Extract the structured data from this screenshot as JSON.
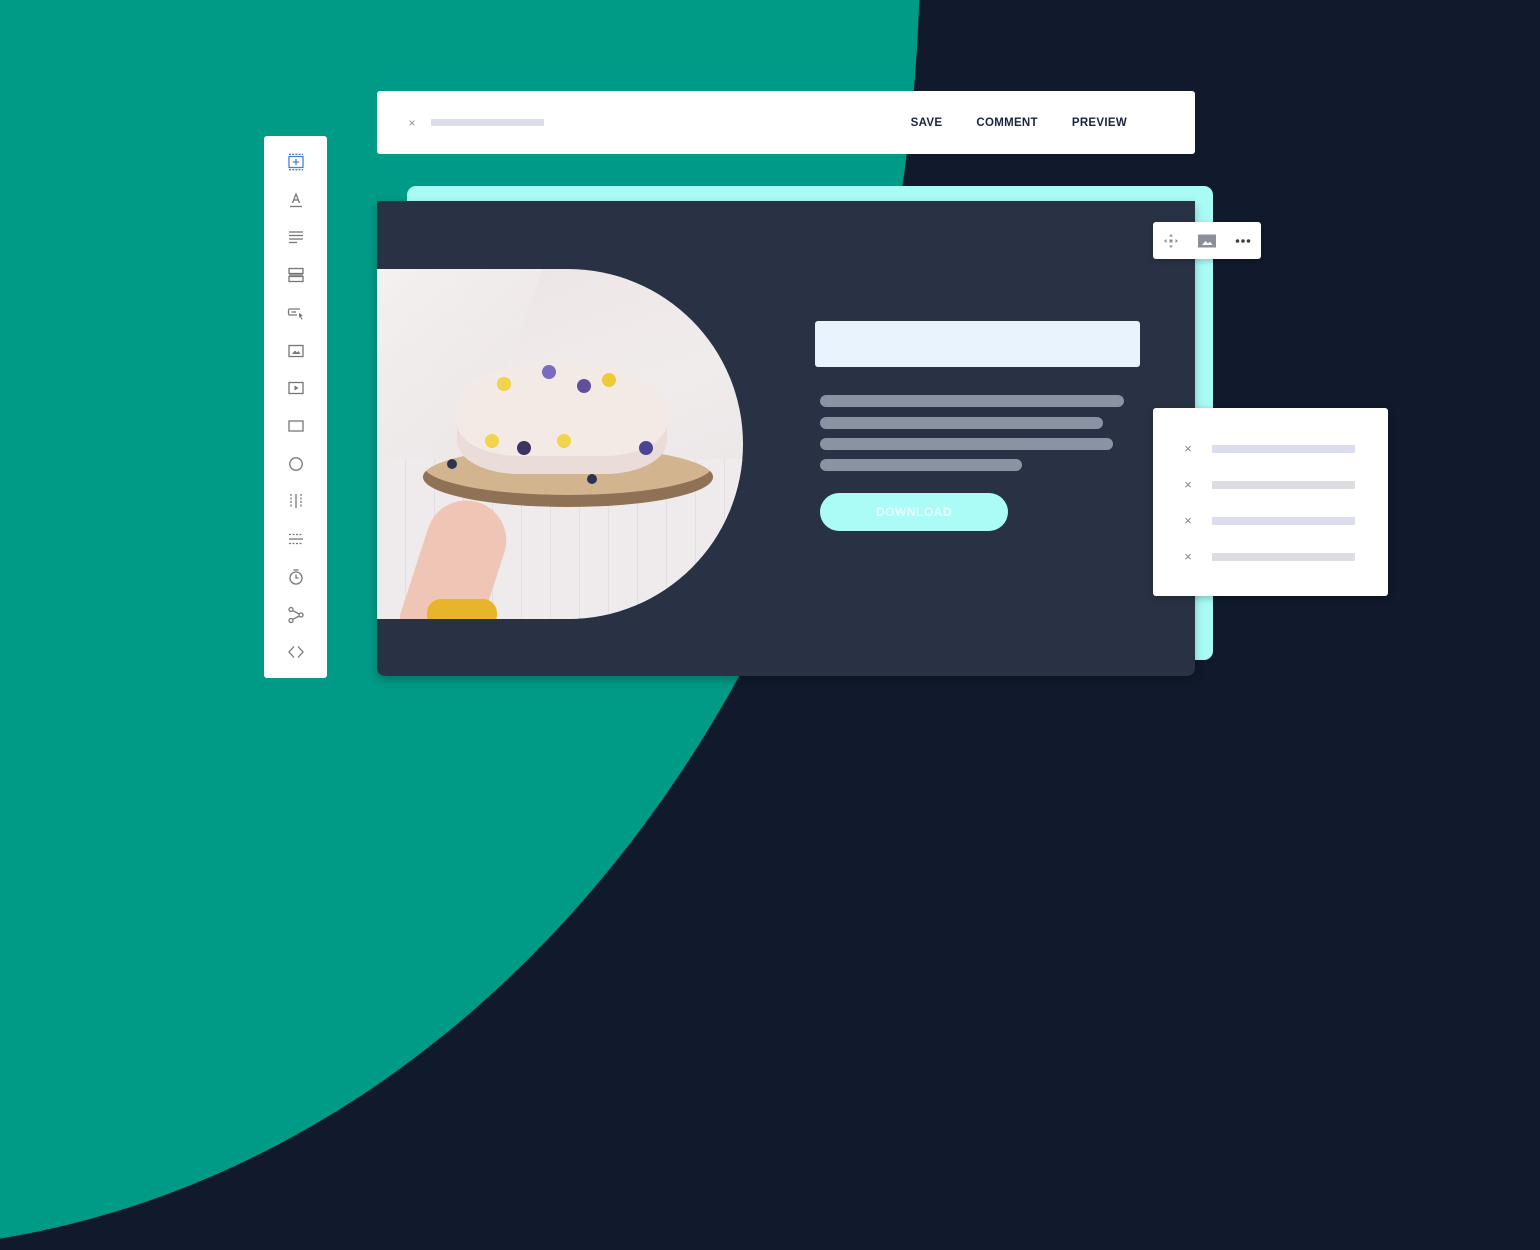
{
  "colors": {
    "background_dark": "#101a2c",
    "background_teal": "#009b86",
    "accent_cyan": "#a9fbf6",
    "canvas": "#283244",
    "heading_placeholder": "#e8f3fe",
    "text_placeholder": "#8993a2",
    "toolbar_text": "#1a2440",
    "active_tool": "#4a7fd6"
  },
  "toolbar": {
    "close_icon": "×",
    "actions": [
      {
        "id": "save",
        "label": "SAVE"
      },
      {
        "id": "comment",
        "label": "COMMENT"
      },
      {
        "id": "preview",
        "label": "PREVIEW"
      }
    ]
  },
  "sidebar": {
    "tools": [
      {
        "id": "add-section",
        "icon": "add-section-icon",
        "active": true
      },
      {
        "id": "text",
        "icon": "text-icon"
      },
      {
        "id": "paragraph",
        "icon": "paragraph-icon"
      },
      {
        "id": "form-fields",
        "icon": "form-fields-icon"
      },
      {
        "id": "button",
        "icon": "button-icon"
      },
      {
        "id": "image",
        "icon": "image-icon"
      },
      {
        "id": "video",
        "icon": "video-icon"
      },
      {
        "id": "box",
        "icon": "rectangle-icon"
      },
      {
        "id": "circle",
        "icon": "circle-icon"
      },
      {
        "id": "columns",
        "icon": "columns-icon"
      },
      {
        "id": "divider",
        "icon": "divider-icon"
      },
      {
        "id": "timer",
        "icon": "timer-icon"
      },
      {
        "id": "social-share",
        "icon": "share-icon"
      },
      {
        "id": "html-code",
        "icon": "code-icon"
      }
    ]
  },
  "canvas": {
    "cta_label": "DOWNLOAD",
    "image_alt": "Hand holding a meringue cake decorated with edible flowers on a wooden board"
  },
  "image_toolbar": {
    "buttons": [
      {
        "id": "move",
        "icon": "move-icon"
      },
      {
        "id": "replace-image",
        "icon": "image-icon"
      },
      {
        "id": "more",
        "icon": "more-icon"
      }
    ]
  },
  "list_panel": {
    "items": [
      {
        "remove_icon": "×"
      },
      {
        "remove_icon": "×"
      },
      {
        "remove_icon": "×"
      },
      {
        "remove_icon": "×"
      }
    ]
  }
}
